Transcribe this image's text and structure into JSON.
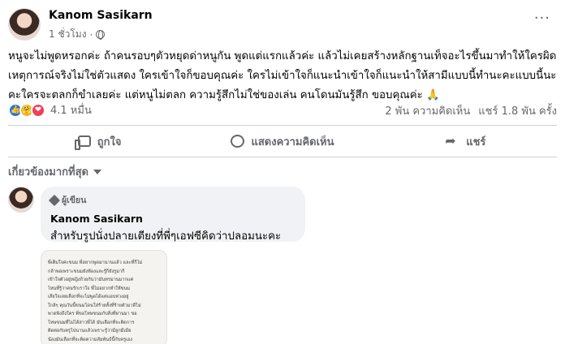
{
  "post": {
    "author": "Kanom Sasikarn",
    "time": "1 ชั่วโมง",
    "privacy_icon": "globe-icon",
    "more_label": "···",
    "text": "หนูจะไม่พูดหรอกค่ะ ถ้าคนรอบๆตัวหยุดด่าหนูกัน พูดแต่แรกแล้วค่ะ แล้วไม่เคยสร้างหลักฐานเท็จอะไรขึ้นมาทำให้ใครผิด เหตุการณ์จริงไม่ใช่ตัวแสดง ใครเข้าใจก็ขอบคุณค่ะ ใครไม่เข้าใจก็แนะนำเข้าใจก็แนะนำให้สามีแบบนี้ทำนะคะแบบนี้นะคะใครจะตลกก็ขำเลยค่ะ แต่หนูไม่ตลก ความรู้สึกไม่ใช่ของเล่น คนโดนมันรู้สึก ขอบคุณค่ะ 🙏"
  },
  "reactions": {
    "count": "4.1 หมื่น",
    "comments": "2 พัน ความคิดเห็น",
    "shares": "แชร์ 1.8 พัน ครั้ง",
    "colors": {
      "like": "#1877f2",
      "care": "#f7b125",
      "love": "#f33e58"
    }
  },
  "actions": {
    "like": "ถูกใจ",
    "comment": "แสดงความคิดเห็น",
    "share": "แชร์"
  },
  "sort_label": "เกี่ยวข้องมากที่สุด",
  "comment": {
    "badge": "ผู้เขียน",
    "author": "Kanom Sasikarn",
    "text": "สำหรับรูปนั่งปลายเตียงที่พี่ๆเอฟซีคิดว่าปลอมนะคะ"
  },
  "attachment": {
    "lines": [
      "พี่เต็มใจค่ะขนม พี่อยากพูดมานานแล้ว และที่ก็ไม่",
      "กล้าพอเพราะขนมยังท้องและรู้ก็ยังรูมาก็",
      "เข้าใจตัวอยู่หญิงถ้วยกันว่ามันทรมานมากแค่",
      "ไหนที่รู้ว่าคนรักเราใจ พี่ไม่อยากทำให้ขนม",
      "เสียใจเลยเลือกที่จะไม่พูดได้แต่แอบห่วงอยู่",
      "ใกล้ๆ คุณวันนี้ขนมโดนใส่ร้ายทั้งที่ร้ายตัวมาดีไม่",
      "พาดพิงถึงใคร พี่ขอโทษขนมกับสิ่งที่ผ่านมา ขอ",
      "โทษขนมที่ไม่ได้สาวพี่ได้ มันเลือกที่จะติดการ",
      "ติดต่อกับครูไปนานแล้วเพราะรู้ว่ามีลูกมีเมีย",
      "น้องมันเลือกที่จะติดความสัมพันธ์นี้กับครูเอง"
    ]
  }
}
